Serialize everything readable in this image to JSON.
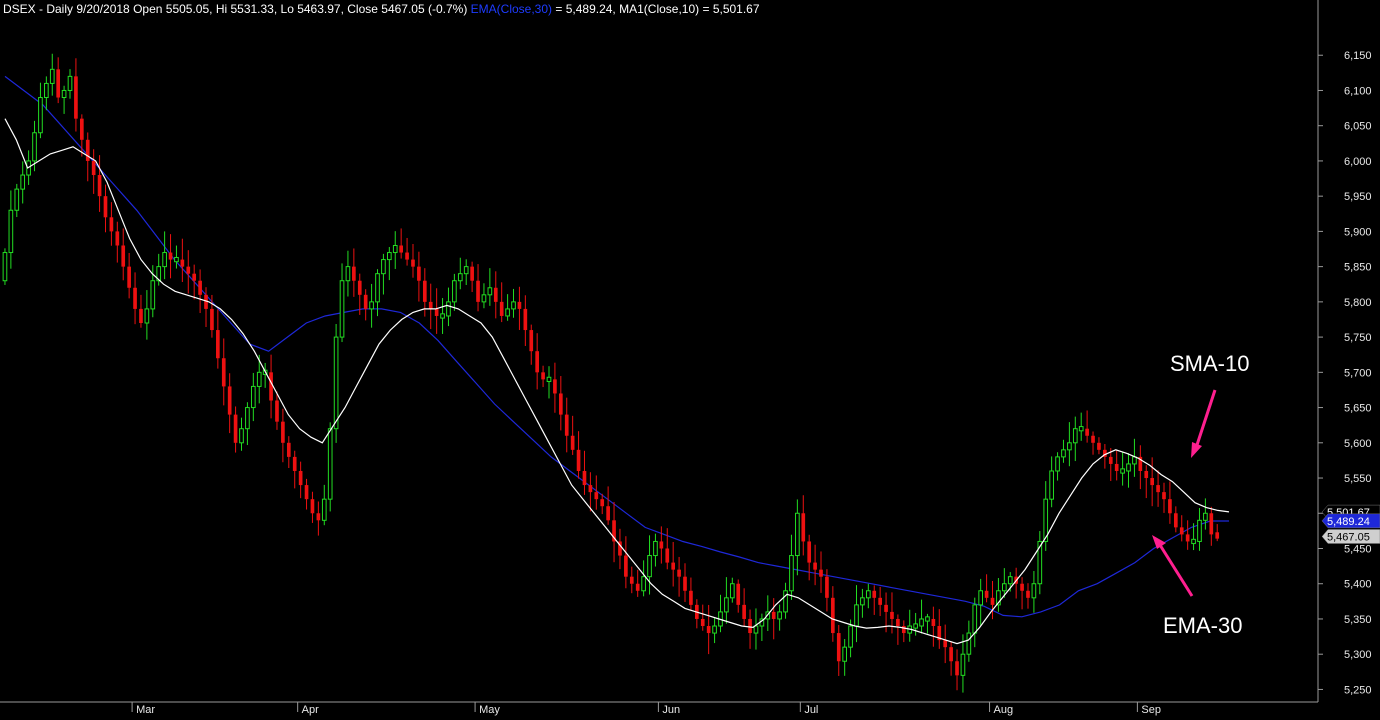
{
  "header": {
    "symbol": "DSEX - Daily 9/20/2018",
    "ohlc": "Open 5505.05, Hi 5531.33, Lo 5463.97, Close 5467.05 (-0.7%)",
    "ema_label": "EMA(Close,30)",
    "ema_value_text": " = 5,489.24,",
    "ma_text": "MA1(Close,10) = 5,501.67"
  },
  "colors": {
    "up": "#22dd22",
    "down": "#ee1111",
    "ema": "#1e28d8",
    "sma": "#ffffff",
    "annotation_arrow": "#ff1f8f",
    "background": "#000000"
  },
  "annotations": {
    "sma_label": "SMA-10",
    "ema_label": "EMA-30"
  },
  "chart_data": {
    "type": "candlestick",
    "ylim": [
      5235,
      6200
    ],
    "y_ticks": [
      6150,
      6100,
      6050,
      6000,
      5950,
      5900,
      5850,
      5800,
      5750,
      5700,
      5650,
      5600,
      5550,
      5500,
      5450,
      5400,
      5350,
      5300,
      5250
    ],
    "y_tick_labels": [
      "6,150",
      "6,100",
      "6,050",
      "6,000",
      "5,950",
      "5,900",
      "5,850",
      "5,800",
      "5,750",
      "5,700",
      "5,650",
      "5,600",
      "5,550",
      "5,500",
      "5,450",
      "5,400",
      "5,350",
      "5,300",
      "5,250"
    ],
    "months": [
      {
        "label": "Mar",
        "index": 22
      },
      {
        "label": "Apr",
        "index": 50
      },
      {
        "label": "May",
        "index": 80
      },
      {
        "label": "Jun",
        "index": 111
      },
      {
        "label": "Jul",
        "index": 135
      },
      {
        "label": "Aug",
        "index": 167
      },
      {
        "label": "Sep",
        "index": 192
      }
    ],
    "candle_count": 208,
    "closes": [
      5870,
      5930,
      5960,
      5980,
      6000,
      6040,
      6090,
      6110,
      6130,
      6090,
      6100,
      6120,
      6060,
      6030,
      6000,
      5980,
      5950,
      5920,
      5900,
      5880,
      5850,
      5820,
      5790,
      5770,
      5790,
      5830,
      5850,
      5870,
      5860,
      5860,
      5850,
      5840,
      5830,
      5810,
      5790,
      5760,
      5720,
      5680,
      5640,
      5600,
      5620,
      5650,
      5680,
      5700,
      5700,
      5660,
      5630,
      5600,
      5580,
      5560,
      5540,
      5520,
      5500,
      5490,
      5520,
      5620,
      5750,
      5830,
      5850,
      5830,
      5810,
      5790,
      5800,
      5840,
      5860,
      5870,
      5880,
      5870,
      5860,
      5850,
      5830,
      5800,
      5790,
      5780,
      5780,
      5800,
      5830,
      5840,
      5850,
      5830,
      5800,
      5810,
      5820,
      5800,
      5780,
      5790,
      5800,
      5790,
      5760,
      5730,
      5700,
      5690,
      5690,
      5670,
      5640,
      5610,
      5590,
      5560,
      5540,
      5530,
      5520,
      5510,
      5490,
      5460,
      5440,
      5410,
      5400,
      5390,
      5410,
      5440,
      5460,
      5450,
      5430,
      5420,
      5410,
      5390,
      5370,
      5350,
      5340,
      5330,
      5340,
      5360,
      5380,
      5400,
      5370,
      5350,
      5330,
      5340,
      5350,
      5360,
      5350,
      5360,
      5390,
      5440,
      5500,
      5460,
      5430,
      5420,
      5410,
      5380,
      5330,
      5290,
      5310,
      5340,
      5370,
      5380,
      5390,
      5380,
      5370,
      5360,
      5350,
      5340,
      5330,
      5340,
      5340,
      5350,
      5350,
      5340,
      5320,
      5310,
      5290,
      5270,
      5300,
      5330,
      5370,
      5390,
      5380,
      5370,
      5390,
      5400,
      5410,
      5400,
      5390,
      5380,
      5400,
      5460,
      5520,
      5560,
      5580,
      5590,
      5600,
      5620,
      5620,
      5610,
      5600,
      5590,
      5580,
      5570,
      5560,
      5560,
      5570,
      5580,
      5560,
      5550,
      5540,
      5530,
      5520,
      5500,
      5480,
      5470,
      5460,
      5460,
      5490,
      5500,
      5470,
      5467
    ],
    "sma_10": [
      6060,
      6030,
      5990,
      6000,
      6010,
      6015,
      6020,
      6010,
      6000,
      5970,
      5930,
      5890,
      5860,
      5840,
      5825,
      5815,
      5810,
      5805,
      5800,
      5790,
      5775,
      5755,
      5730,
      5700,
      5670,
      5640,
      5620,
      5608,
      5600,
      5625,
      5650,
      5680,
      5710,
      5740,
      5760,
      5775,
      5785,
      5790,
      5790,
      5795,
      5790,
      5780,
      5770,
      5750,
      5720,
      5690,
      5660,
      5630,
      5600,
      5570,
      5540,
      5520,
      5500,
      5480,
      5460,
      5440,
      5420,
      5400,
      5385,
      5375,
      5365,
      5360,
      5355,
      5350,
      5345,
      5340,
      5338,
      5350,
      5370,
      5385,
      5380,
      5370,
      5360,
      5350,
      5345,
      5340,
      5337,
      5338,
      5340,
      5338,
      5335,
      5330,
      5325,
      5320,
      5315,
      5320,
      5338,
      5360,
      5380,
      5400,
      5420,
      5445,
      5470,
      5500,
      5525,
      5550,
      5570,
      5583,
      5590,
      5585,
      5578,
      5568,
      5555,
      5545,
      5530,
      5515,
      5508,
      5504,
      5502
    ],
    "ema_30": [
      6120,
      6100,
      6080,
      6050,
      6020,
      5990,
      5960,
      5930,
      5895,
      5860,
      5830,
      5800,
      5770,
      5740,
      5730,
      5750,
      5770,
      5780,
      5785,
      5790,
      5790,
      5785,
      5770,
      5745,
      5715,
      5685,
      5655,
      5630,
      5605,
      5580,
      5560,
      5540,
      5520,
      5500,
      5480,
      5470,
      5460,
      5453,
      5445,
      5438,
      5430,
      5425,
      5420,
      5415,
      5410,
      5405,
      5400,
      5395,
      5390,
      5385,
      5380,
      5375,
      5368,
      5355,
      5353,
      5360,
      5370,
      5390,
      5400,
      5415,
      5430,
      5450,
      5465,
      5480,
      5489,
      5489
    ]
  }
}
